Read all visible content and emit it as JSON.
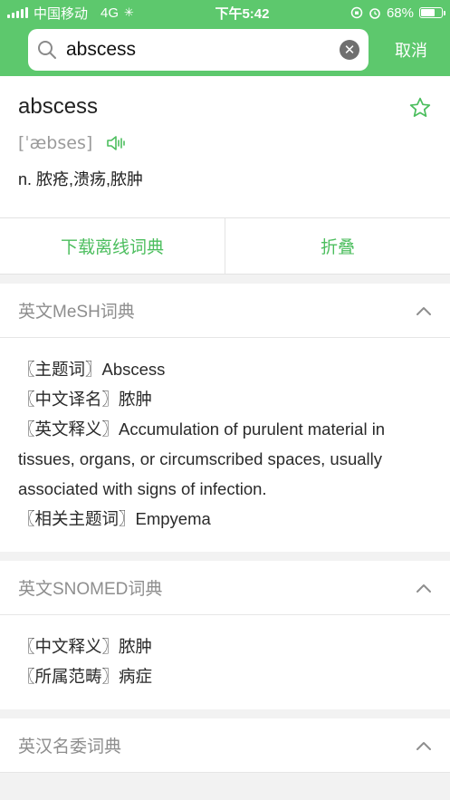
{
  "status_bar": {
    "carrier": "中国移动",
    "network": "4G",
    "time": "下午5:42",
    "battery_percent": "68%",
    "battery_level": 0.68
  },
  "search": {
    "value": "abscess",
    "cancel_label": "取消",
    "search_icon": "search-icon",
    "clear_icon": "clear-icon"
  },
  "entry": {
    "word": "abscess",
    "phonetic": "[ˈæbses]",
    "definition": "n. 脓疮,溃疡,脓肿",
    "star_icon": "star-outline-icon",
    "speaker_icon": "speaker-icon"
  },
  "actions": {
    "download_label": "下载离线词典",
    "collapse_label": "折叠"
  },
  "sections": [
    {
      "title": "英文MeSH词典",
      "lines": [
        "〖主题词〗Abscess",
        "〖中文译名〗脓肿",
        "〖英文释义〗Accumulation of purulent material in tissues, organs, or circumscribed spaces, usually associated with signs of infection.",
        "〖相关主题词〗Empyema"
      ]
    },
    {
      "title": "英文SNOMED词典",
      "lines": [
        "〖中文释义〗脓肿",
        "〖所属范畴〗病症"
      ]
    },
    {
      "title": "英汉名委词典",
      "lines": []
    }
  ],
  "colors": {
    "accent": "#5dc86d",
    "action_text": "#4cbe5e"
  }
}
